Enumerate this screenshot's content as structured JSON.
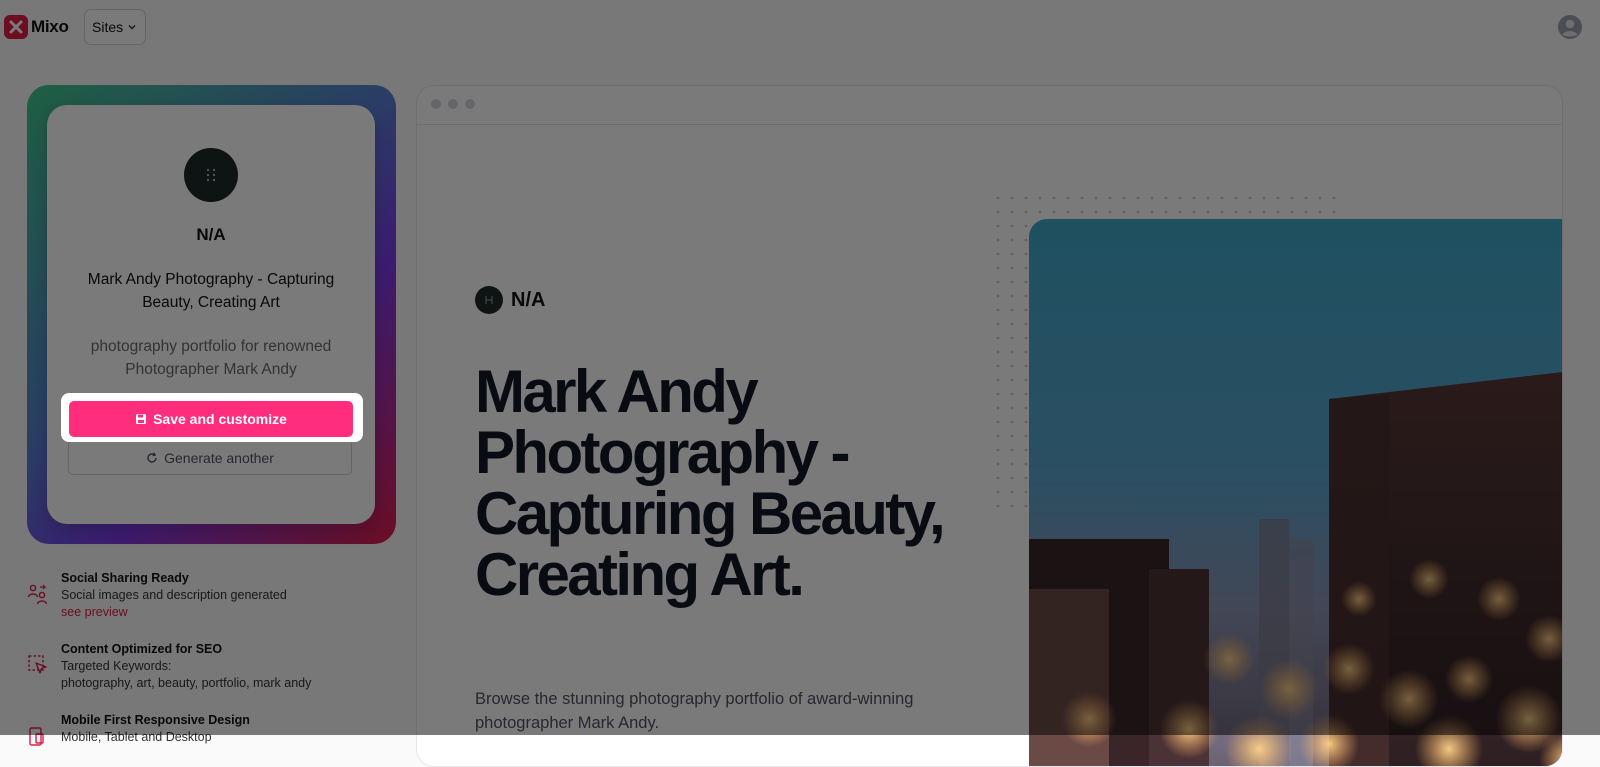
{
  "topbar": {
    "brand": "Mixo",
    "sites_label": "Sites"
  },
  "card": {
    "site_name": "N/A",
    "title": "Mark Andy Photography - Capturing Beauty, Creating Art",
    "description": "photography portfolio for renowned Photographer Mark Andy",
    "save_label": "Save and customize",
    "generate_label": "Generate another"
  },
  "features": [
    {
      "title": "Social Sharing Ready",
      "line1": "Social images and description generated",
      "link": "see preview",
      "icon": "people-share-icon"
    },
    {
      "title": "Content Optimized for SEO",
      "line1": "Targeted Keywords:",
      "line2": "photography, art, beauty, portfolio, mark andy",
      "icon": "cursor-select-icon"
    },
    {
      "title": "Mobile First Responsive Design",
      "line1": "Mobile, Tablet and Desktop",
      "icon": "devices-icon"
    }
  ],
  "preview": {
    "brand_name": "N/A",
    "hero_title": "Mark Andy Photography - Capturing Beauty, Creating Art.",
    "hero_subtitle": "Browse the stunning photography portfolio of award-winning photographer Mark Andy."
  },
  "colors": {
    "accent": "#ff2d7c",
    "brand": "#e11d48",
    "dark": "#1f2a2a"
  }
}
